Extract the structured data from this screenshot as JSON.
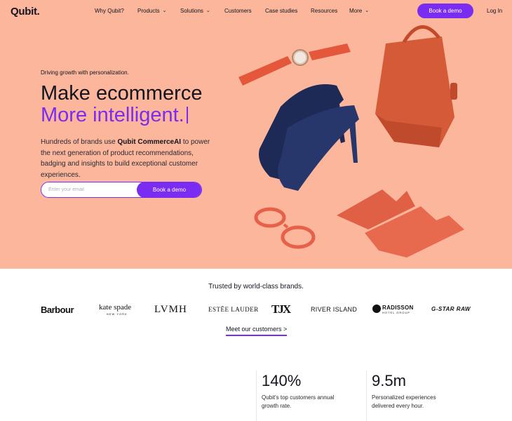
{
  "nav": {
    "logo": "Qubit.",
    "items": [
      {
        "label": "Why Qubit?",
        "dropdown": false
      },
      {
        "label": "Products",
        "dropdown": true
      },
      {
        "label": "Solutions",
        "dropdown": true
      },
      {
        "label": "Customers",
        "dropdown": false
      },
      {
        "label": "Case studies",
        "dropdown": false
      },
      {
        "label": "Resources",
        "dropdown": false
      },
      {
        "label": "More",
        "dropdown": true
      }
    ],
    "cta_label": "Book a demo",
    "login_label": "Log In"
  },
  "hero": {
    "tagline": "Driving growth with personalization.",
    "headline": "Make ecommerce",
    "headline_accent": "More intelligent.",
    "description_prefix": "Hundreds of brands use ",
    "description_bold": "Qubit CommerceAI",
    "description_suffix": " to power the next generation of product recommendations, badging and insights to build exceptional customer experiences.",
    "email_placeholder": "Enter your email",
    "email_value": "",
    "submit_label": "Book a demo"
  },
  "trusted": {
    "title": "Trusted by world-class brands.",
    "brands": {
      "barbour": "Barbour",
      "kate_spade": "kate spade",
      "kate_spade_sub": "NEW YORK",
      "lvmh": "LVMH",
      "estee": "ESTĒE LAUDER",
      "tjx": "TJX",
      "river_island": "RIVER ISLAND",
      "radisson": "RADISSON",
      "radisson_sub": "HOTEL GROUP",
      "radisson_mark": "RHG",
      "gstar": "G-STAR RAW"
    },
    "link_label": "Meet our customers >"
  },
  "stats": [
    {
      "value": "140%",
      "description": "Qubit's top customers annual growth rate."
    },
    {
      "value": "9.5m",
      "description": "Personalized experiences delivered every hour."
    }
  ],
  "colors": {
    "accent": "#7a2cf0",
    "hero_bg": "#fbb69b",
    "text": "#14141f"
  },
  "icons": {
    "dropdown": "chevron-down-icon"
  }
}
